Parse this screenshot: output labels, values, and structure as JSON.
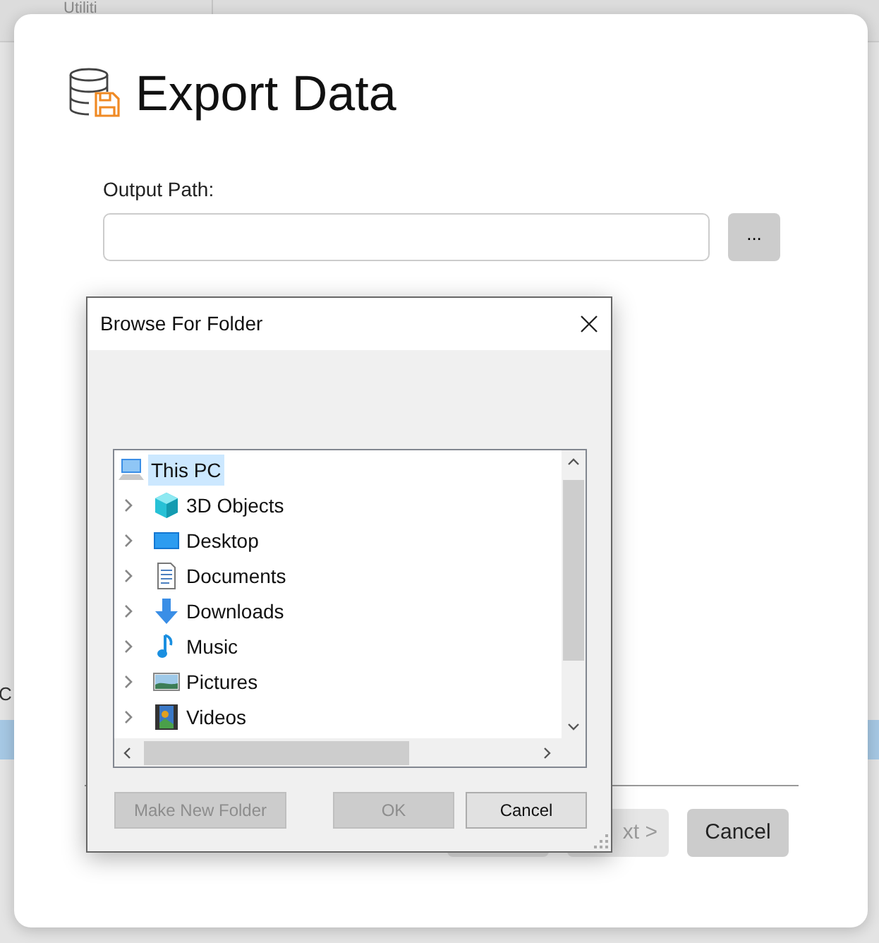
{
  "background": {
    "menu_label": "Utiliti",
    "row_label": "C"
  },
  "wizard": {
    "title": "Export Data",
    "output_path": {
      "label": "Output Path:"
    },
    "browse_button": "...",
    "buttons": [
      {
        "kind": "back",
        "disabled": true
      },
      {
        "kind": "next",
        "label": "xt >",
        "disabled": true
      },
      {
        "kind": "cancel",
        "label": "Cancel",
        "disabled": false
      }
    ]
  },
  "folder_dialog": {
    "title": "Browse For Folder",
    "tree": [
      {
        "label": "This PC",
        "kind": "computer",
        "selected": true,
        "children": [
          {
            "label": "3D Objects",
            "kind": "cube",
            "selected": false,
            "expanded": false
          },
          {
            "label": "Desktop",
            "kind": "desktop",
            "selected": false,
            "expanded": false
          },
          {
            "label": "Documents",
            "kind": "document",
            "selected": false,
            "expanded": false
          },
          {
            "label": "Downloads",
            "kind": "download",
            "selected": false,
            "expanded": false
          },
          {
            "label": "Music",
            "kind": "music",
            "selected": false,
            "expanded": false
          },
          {
            "label": "Pictures",
            "kind": "pictures",
            "selected": false,
            "expanded": false
          },
          {
            "label": "Videos",
            "kind": "videos",
            "selected": false,
            "expanded": false
          }
        ]
      }
    ],
    "buttons": [
      {
        "label": "Make New Folder",
        "disabled": true
      },
      {
        "label": "OK",
        "disabled": true
      },
      {
        "label": "Cancel",
        "disabled": false
      }
    ]
  }
}
